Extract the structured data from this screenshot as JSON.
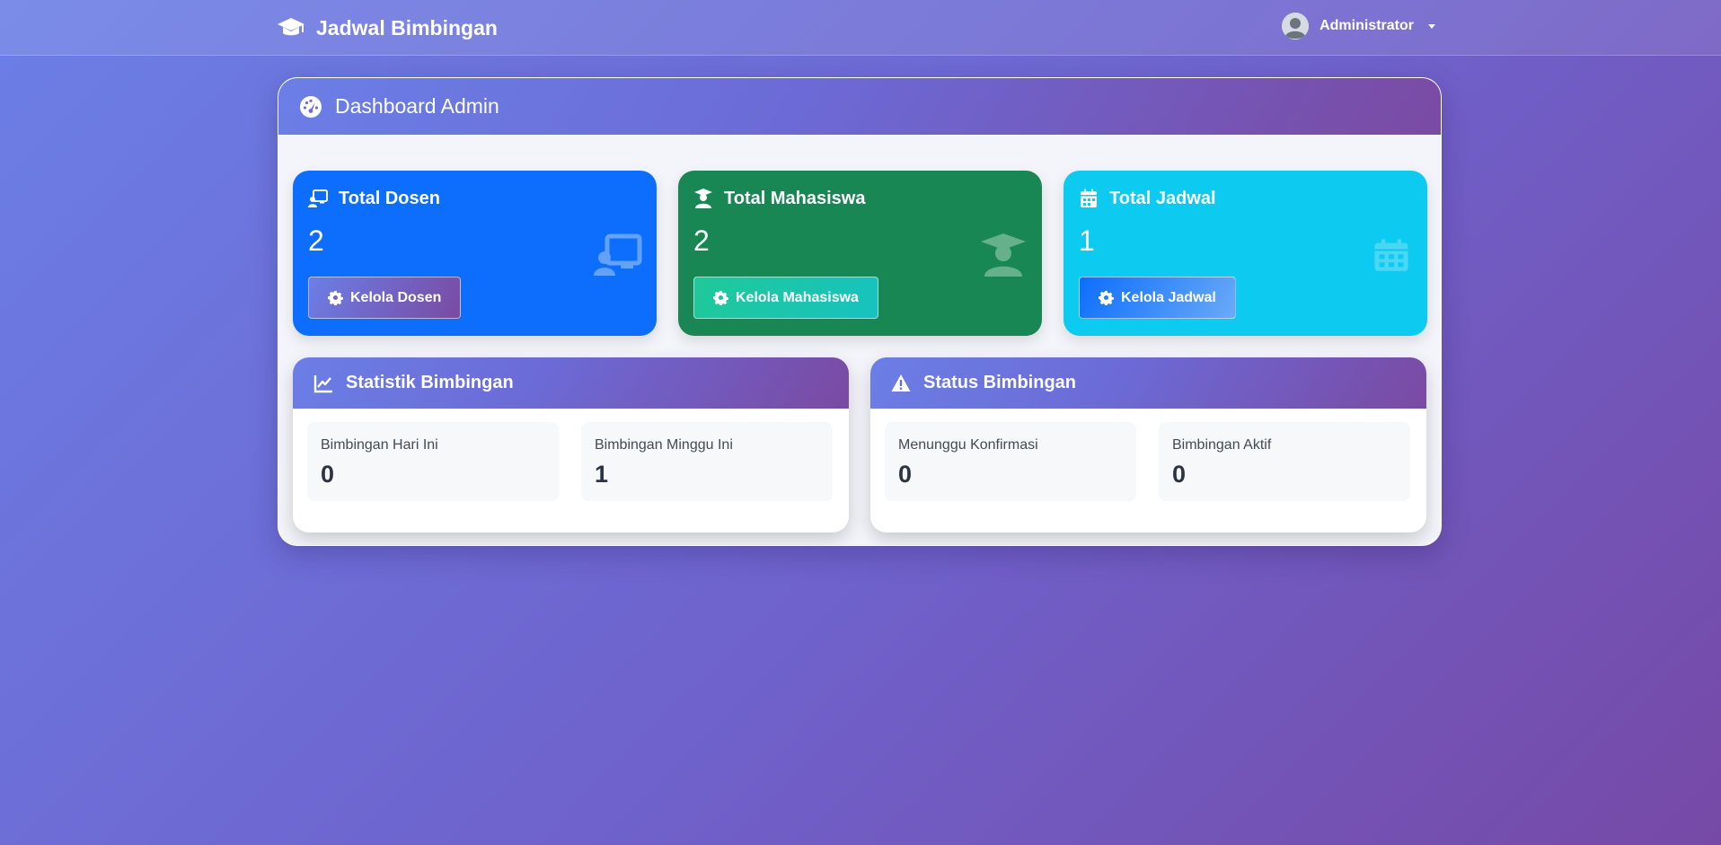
{
  "navbar": {
    "brand": "Jadwal Bimbingan",
    "brand_icon": "graduation-cap-icon",
    "user": "Administrator"
  },
  "dashboard": {
    "title": "Dashboard Admin",
    "title_icon": "tachometer-icon"
  },
  "stats": [
    {
      "title": "Total Dosen",
      "value": "2",
      "button": "Kelola Dosen",
      "icon": "chalkboard-teacher-icon",
      "color": "#0d6efd"
    },
    {
      "title": "Total Mahasiswa",
      "value": "2",
      "button": "Kelola Mahasiswa",
      "icon": "user-graduate-icon",
      "color": "#198754"
    },
    {
      "title": "Total Jadwal",
      "value": "1",
      "button": "Kelola Jadwal",
      "icon": "calendar-icon",
      "color": "#0dcaf0"
    }
  ],
  "statistik": {
    "title": "Statistik Bimbingan",
    "icon": "chart-line-icon",
    "items": [
      {
        "label": "Bimbingan Hari Ini",
        "value": "0"
      },
      {
        "label": "Bimbingan Minggu Ini",
        "value": "1"
      }
    ]
  },
  "status": {
    "title": "Status Bimbingan",
    "icon": "warning-icon",
    "items": [
      {
        "label": "Menunggu Konfirmasi",
        "value": "0"
      },
      {
        "label": "Bimbingan Aktif",
        "value": "0"
      }
    ]
  }
}
